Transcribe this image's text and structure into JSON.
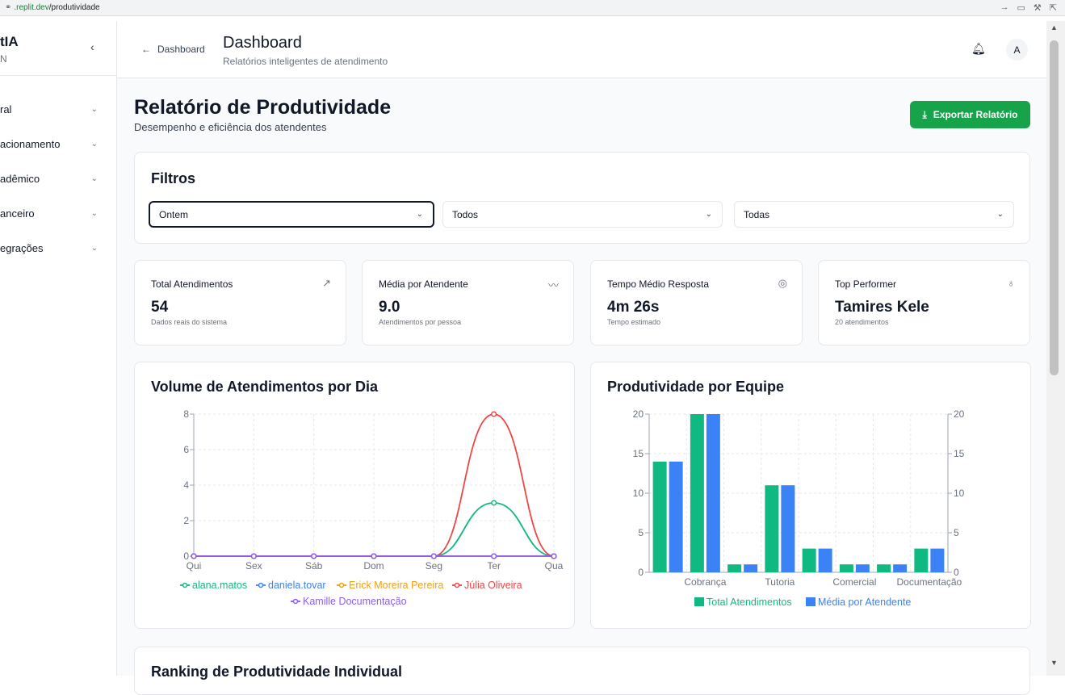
{
  "browser": {
    "url_domain": ".replit.dev",
    "url_path": "/produtividade"
  },
  "sidebar": {
    "brand": "tIA",
    "brand_sub": "N",
    "items": [
      {
        "label": "ral"
      },
      {
        "label": "acionamento"
      },
      {
        "label": "adêmico"
      },
      {
        "label": "anceiro"
      },
      {
        "label": "egrações"
      }
    ]
  },
  "topbar": {
    "back_label": "Dashboard",
    "title": "Dashboard",
    "subtitle": "Relatórios inteligentes de atendimento",
    "avatar_initial": "A"
  },
  "page": {
    "title": "Relatório de Produtividade",
    "subtitle": "Desempenho e eficiência dos atendentes",
    "export_label": "Exportar Relatório"
  },
  "filters": {
    "title": "Filtros",
    "selects": [
      {
        "value": "Ontem"
      },
      {
        "value": "Todos"
      },
      {
        "value": "Todas"
      }
    ]
  },
  "kpis": [
    {
      "label": "Total Atendimentos",
      "value": "54",
      "sub": "Dados reais do sistema",
      "icon": "trending-up-icon"
    },
    {
      "label": "Média por Atendente",
      "value": "9.0",
      "sub": "Atendimentos por pessoa",
      "icon": "activity-icon"
    },
    {
      "label": "Tempo Médio Resposta",
      "value": "4m 26s",
      "sub": "Tempo estimado",
      "icon": "target-icon"
    },
    {
      "label": "Top Performer",
      "value": "Tamires Kele",
      "sub": "20 atendimentos",
      "icon": "award-icon"
    }
  ],
  "chart_data": [
    {
      "type": "line",
      "title": "Volume de Atendimentos por Dia",
      "categories": [
        "Qui",
        "Sex",
        "Sáb",
        "Dom",
        "Seg",
        "Ter",
        "Qua"
      ],
      "ylim": [
        0,
        8
      ],
      "yticks": [
        0,
        2,
        4,
        6,
        8
      ],
      "grid": true,
      "legend": "bottom",
      "series": [
        {
          "name": "alana.matos",
          "color": "#10b981",
          "values": [
            0,
            0,
            0,
            0,
            0,
            3,
            0
          ]
        },
        {
          "name": "daniela.tovar",
          "color": "#3b82f6",
          "values": [
            0,
            0,
            0,
            0,
            0,
            0,
            0
          ]
        },
        {
          "name": "Erick Moreira Pereira",
          "color": "#f59e0b",
          "values": [
            0,
            0,
            0,
            0,
            0,
            0,
            0
          ]
        },
        {
          "name": "Júlia Oliveira",
          "color": "#ef4444",
          "values": [
            0,
            0,
            0,
            0,
            0,
            8,
            0
          ]
        },
        {
          "name": "Kamille Documentação",
          "color": "#8b5cf6",
          "values": [
            0,
            0,
            0,
            0,
            0,
            0,
            0
          ]
        }
      ]
    },
    {
      "type": "bar",
      "title": "Produtividade por Equipe",
      "categories": [
        "",
        "Cobrança",
        "",
        "Tutoria",
        "",
        "Comercial",
        "",
        "Documentação"
      ],
      "ylim": [
        0,
        20
      ],
      "yticks": [
        0,
        5,
        10,
        15,
        20
      ],
      "grid": true,
      "legend": "bottom",
      "series": [
        {
          "name": "Total Atendimentos",
          "color": "#10b981",
          "values": [
            14,
            20,
            1,
            11,
            3,
            1,
            1,
            3
          ]
        },
        {
          "name": "Média por Atendente",
          "color": "#3b82f6",
          "values": [
            14,
            20,
            1,
            11,
            3,
            1,
            1,
            3
          ]
        }
      ]
    }
  ],
  "ranking": {
    "title": "Ranking de Produtividade Individual"
  }
}
